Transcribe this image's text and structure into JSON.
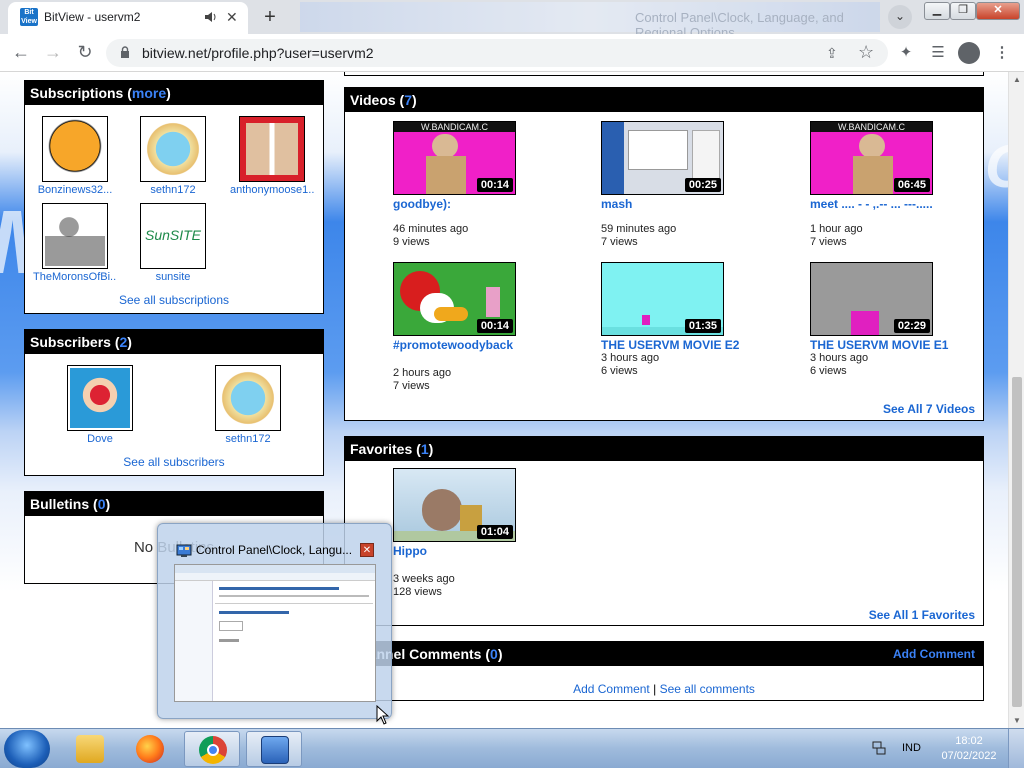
{
  "browser": {
    "tab_title": "BitView - uservm2",
    "favicon_text": "Bit View",
    "url": "bitview.net/profile.php?user=uservm2",
    "background_title": "Control Panel\\Clock, Language, and Regional Options"
  },
  "subscriptions": {
    "title": "Subscriptions",
    "open_paren": " (",
    "more": "more",
    "close_paren": ")",
    "items": [
      {
        "name": "Bonzinews32..."
      },
      {
        "name": "sethn172"
      },
      {
        "name": "anthonymoose1..."
      },
      {
        "name": "TheMoronsOfBi..."
      },
      {
        "name": "sunsite",
        "thumb_text": "SunSITE"
      }
    ],
    "see_all": "See all subscriptions"
  },
  "subscribers": {
    "title": "Subscribers",
    "count": "2",
    "items": [
      {
        "name": "Dove"
      },
      {
        "name": "sethn172"
      }
    ],
    "see_all": "See all subscribers"
  },
  "bulletins": {
    "title": "Bulletins",
    "count": "0",
    "empty_text": "No Bulletins"
  },
  "videos": {
    "title": "Videos",
    "count": "7",
    "items": [
      {
        "title": "goodbye):",
        "duration": "00:14",
        "age": "46 minutes ago",
        "views": "9 views",
        "thumb_banner": "W.BANDICAM.C"
      },
      {
        "title": "mash",
        "duration": "00:25",
        "age": "59 minutes ago",
        "views": "7 views"
      },
      {
        "title": "meet .... - - ,.-- ... ---.....",
        "duration": "06:45",
        "age": "1 hour ago",
        "views": "7 views",
        "thumb_banner": "W.BANDICAM.C"
      },
      {
        "title": "#promotewoodyback",
        "duration": "00:14",
        "age": "2 hours ago",
        "views": "7 views"
      },
      {
        "title": "THE USERVM MOVIE E2",
        "duration": "01:35",
        "age": "3 hours ago",
        "views": "6 views"
      },
      {
        "title": "THE USERVM MOVIE E1",
        "duration": "02:29",
        "age": "3 hours ago",
        "views": "6 views"
      }
    ],
    "see_all": "See All 7 Videos"
  },
  "favorites": {
    "title": "Favorites",
    "count": "1",
    "items": [
      {
        "title": "Hippo",
        "duration": "01:04",
        "age": "3 weeks ago",
        "views": "128 views"
      }
    ],
    "see_all": "See All 1 Favorites"
  },
  "comments": {
    "title": "Channel Comments",
    "count": "0",
    "add_comment_header": "Add Comment",
    "add_comment": "Add Comment",
    "separator": " | ",
    "see_all": "See all comments"
  },
  "peek": {
    "title": "Control Panel\\Clock, Langu..."
  },
  "taskbar": {
    "language": "IND",
    "time": "18:02",
    "date": "07/02/2022"
  },
  "colors": {
    "link": "#1a66d2",
    "count": "#3b82f6",
    "header_bg": "#000000"
  }
}
